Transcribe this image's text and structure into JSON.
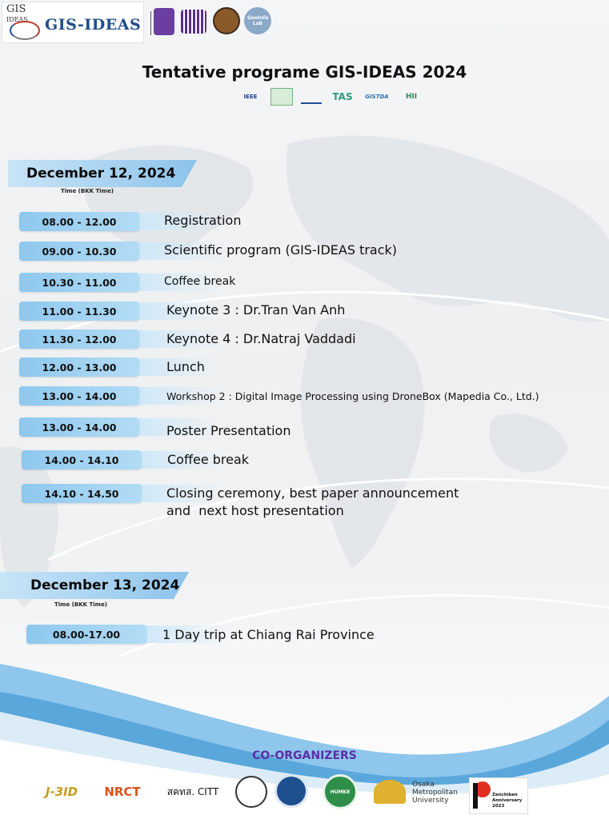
{
  "header": {
    "logo_top": "GIS",
    "logo_small": "IDEAS",
    "logo_word": "GIS-IDEAS",
    "seal_labels": [
      "",
      "",
      "",
      "GeoInfo Lab"
    ]
  },
  "title": "Tentative programe GIS-IDEAS 2024",
  "sponsors": [
    "IEEE",
    "",
    "",
    "TAS",
    "GISTDA",
    "HII"
  ],
  "day1": {
    "date": "December 12, 2024",
    "time_label": "Time (BKK Time)",
    "items": [
      {
        "time": "08.00 - 12.00",
        "activity": "Registration"
      },
      {
        "time": "09.00 - 10.30",
        "activity": "Scientific program (GIS-IDEAS track)"
      },
      {
        "time": "10.30 - 11.00",
        "activity": "Coffee break"
      },
      {
        "time": "11.00 - 11.30",
        "activity": "Keynote 3 : Dr.Tran Van Anh"
      },
      {
        "time": "11.30 - 12.00",
        "activity": "Keynote 4 : Dr.Natraj Vaddadi"
      },
      {
        "time": "12.00 - 13.00",
        "activity": "Lunch"
      },
      {
        "time": "13.00 - 14.00",
        "activity": "Workshop 2 : Digital Image Processing using DroneBox (Mapedia Co., Ltd.)"
      },
      {
        "time": "13.00 - 14.00",
        "activity": "Poster Presentation"
      },
      {
        "time": "14.00 - 14.10",
        "activity": "Coffee break"
      },
      {
        "time": "14.10 - 14.50",
        "activity": "Closing ceremony, best paper announcement",
        "activity2": "and  next host presentation"
      }
    ]
  },
  "day2": {
    "date": "December 13, 2024",
    "time_label": "Time (BKK Time)",
    "items": [
      {
        "time": "08.00-17.00",
        "activity": "1 Day trip at Chiang Rai Province"
      }
    ]
  },
  "coorganizers": {
    "heading": "CO-ORGANIZERS",
    "logos": [
      "J-3ID",
      "NRCT",
      "สคทส. CITT",
      "",
      "",
      "HUMKE",
      "Osaka Metropolitan University",
      "Zenchiken Anniversary 2023"
    ]
  }
}
